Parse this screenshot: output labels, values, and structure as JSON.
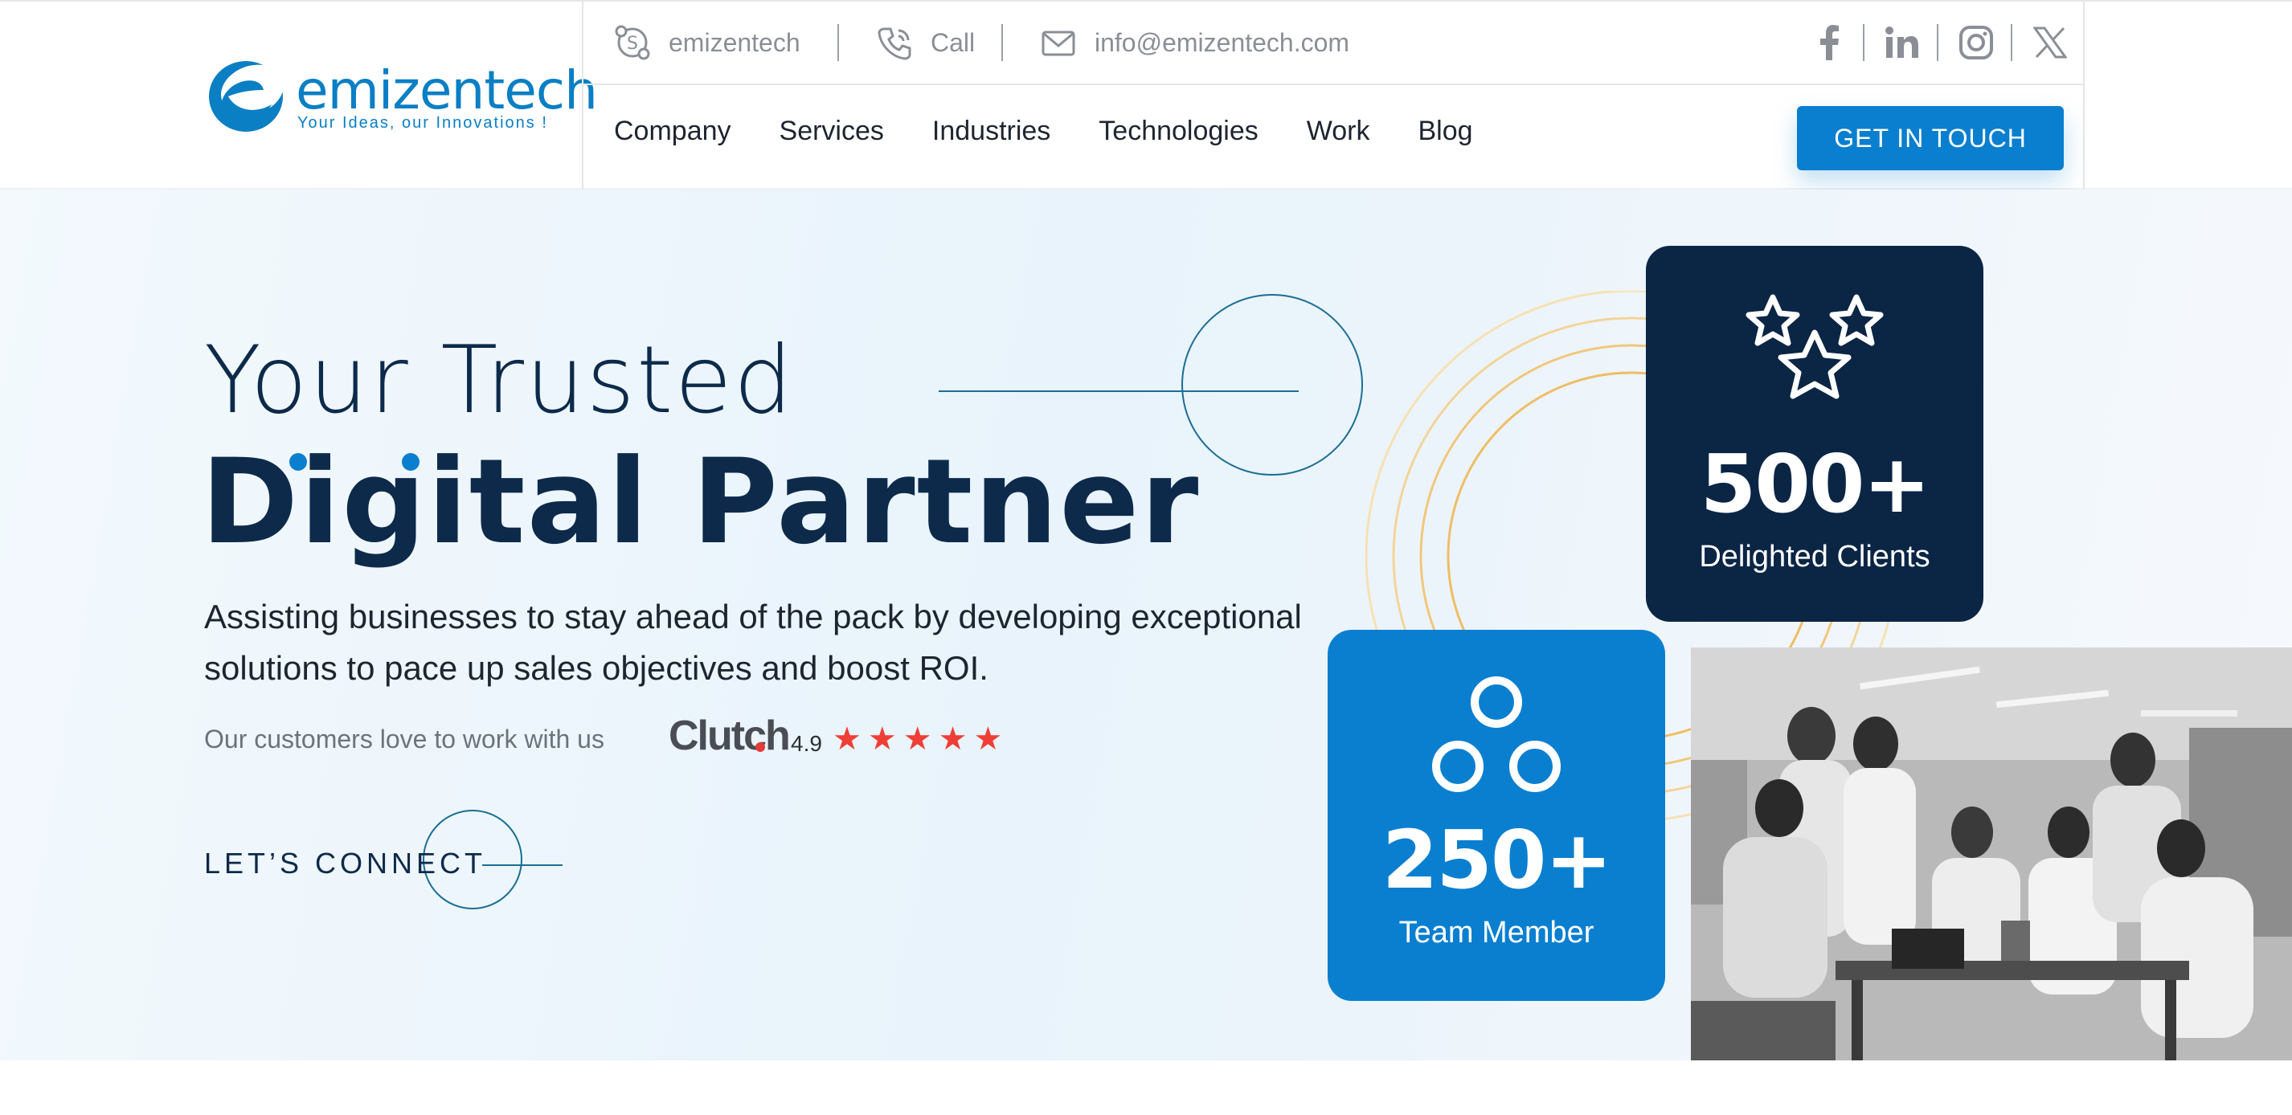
{
  "brand": {
    "name": "emizentech",
    "tagline": "Your Ideas, our Innovations !",
    "primary_color": "#0a7fcf",
    "dark_color": "#0b2545"
  },
  "topbar": {
    "skype_label": "emizentech",
    "call_label": "Call",
    "email_label": "info@emizentech.com",
    "social": [
      "facebook-icon",
      "linkedin-icon",
      "instagram-icon",
      "x-icon"
    ]
  },
  "nav": {
    "items": [
      "Company",
      "Services",
      "Industries",
      "Technologies",
      "Work",
      "Blog"
    ],
    "cta_label": "GET IN TOUCH"
  },
  "hero": {
    "title_line1": "Your Trusted",
    "title_line2": "Digital Partner",
    "subtitle": "Assisting businesses to stay ahead of the pack by developing exceptional solutions to pace up sales objectives and boost ROI.",
    "love_text": "Our customers love to work with us",
    "clutch_label": "Clutch",
    "clutch_rating": "4.9",
    "stars": 5,
    "cta_label": "LET’S CONNECT"
  },
  "stats": {
    "clients": {
      "value": "500+",
      "label": "Delighted Clients",
      "icon": "stars-icon"
    },
    "team": {
      "value": "250+",
      "label": "Team Member",
      "icon": "team-circles-icon"
    }
  },
  "photo": {
    "subject": "team-photo"
  }
}
